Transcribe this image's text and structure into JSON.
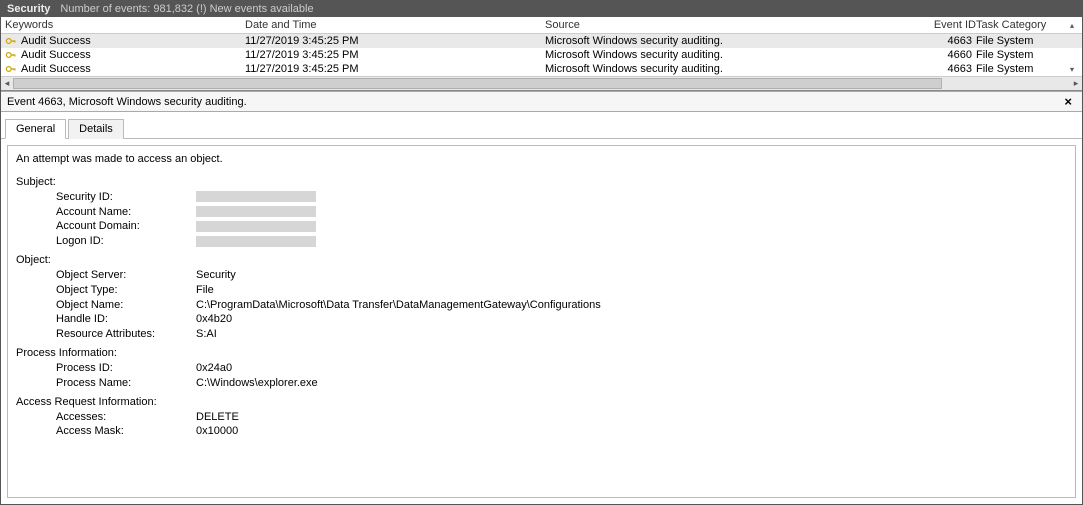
{
  "titlebar": {
    "section": "Security",
    "sub": "Number of events: 981,832 (!) New events available"
  },
  "columns": {
    "keywords": "Keywords",
    "datetime": "Date and Time",
    "source": "Source",
    "eventid": "Event ID",
    "task": "Task Category"
  },
  "events": [
    {
      "keywords": "Audit Success",
      "datetime": "11/27/2019 3:45:25 PM",
      "source": "Microsoft Windows security auditing.",
      "eventid": "4663",
      "task": "File System",
      "selected": true
    },
    {
      "keywords": "Audit Success",
      "datetime": "11/27/2019 3:45:25 PM",
      "source": "Microsoft Windows security auditing.",
      "eventid": "4660",
      "task": "File System",
      "selected": false
    },
    {
      "keywords": "Audit Success",
      "datetime": "11/27/2019 3:45:25 PM",
      "source": "Microsoft Windows security auditing.",
      "eventid": "4663",
      "task": "File System",
      "selected": false
    }
  ],
  "detail": {
    "header": "Event 4663, Microsoft Windows security auditing.",
    "tabs": {
      "general": "General",
      "details": "Details"
    },
    "close": "×",
    "message": "An attempt was made to access an object.",
    "sections": {
      "subject": {
        "title": "Subject:",
        "rows": [
          {
            "k": "Security ID:",
            "v": "",
            "redacted": true
          },
          {
            "k": "Account Name:",
            "v": "",
            "redacted": true
          },
          {
            "k": "Account Domain:",
            "v": "",
            "redacted": true
          },
          {
            "k": "Logon ID:",
            "v": "",
            "redacted": true
          }
        ]
      },
      "object": {
        "title": "Object:",
        "rows": [
          {
            "k": "Object Server:",
            "v": "Security"
          },
          {
            "k": "Object Type:",
            "v": "File"
          },
          {
            "k": "Object Name:",
            "v": "C:\\ProgramData\\Microsoft\\Data Transfer\\DataManagementGateway\\Configurations"
          },
          {
            "k": "Handle ID:",
            "v": "0x4b20"
          },
          {
            "k": "Resource Attributes:",
            "v": "S:AI"
          }
        ]
      },
      "process": {
        "title": "Process Information:",
        "rows": [
          {
            "k": "Process ID:",
            "v": "0x24a0"
          },
          {
            "k": "Process Name:",
            "v": "C:\\Windows\\explorer.exe"
          }
        ]
      },
      "access": {
        "title": "Access Request Information:",
        "rows": [
          {
            "k": "Accesses:",
            "v": "DELETE"
          },
          {
            "k": "",
            "v": ""
          },
          {
            "k": "Access Mask:",
            "v": "0x10000"
          }
        ]
      }
    }
  }
}
